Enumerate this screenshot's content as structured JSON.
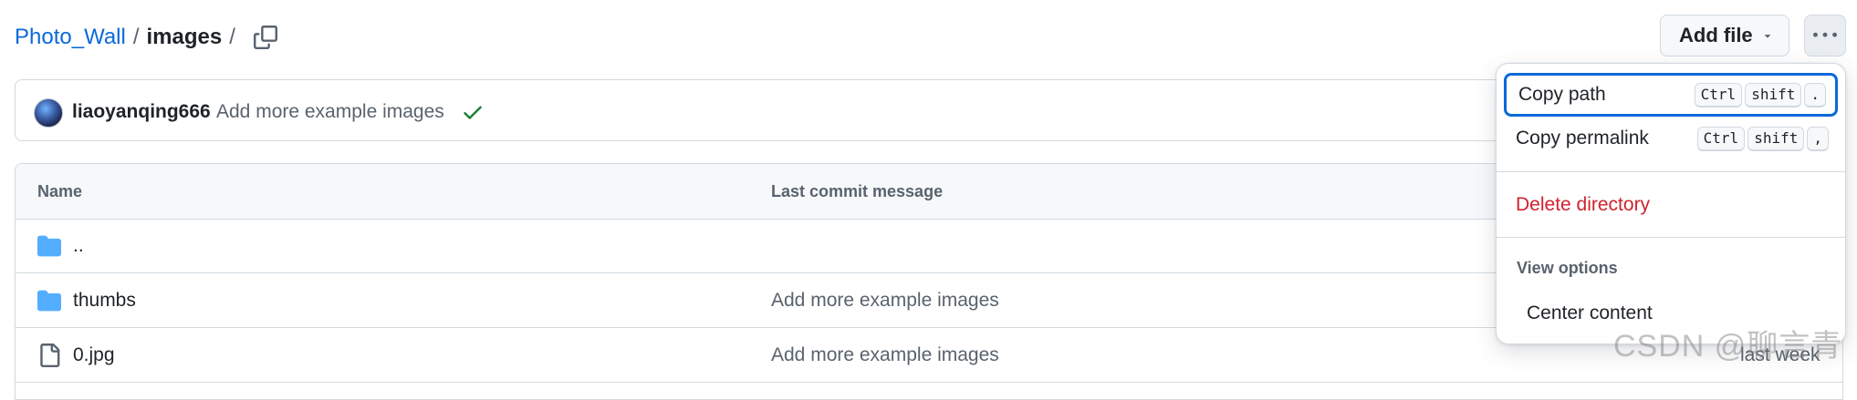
{
  "breadcrumb": {
    "repo": "Photo_Wall",
    "sep": "/",
    "dir": "images",
    "trail": "/"
  },
  "header": {
    "add_file_label": "Add file"
  },
  "commit": {
    "author": "liaoyanqing666",
    "message": "Add more example images",
    "status_color": "#1a7f37"
  },
  "table": {
    "headers": {
      "name": "Name",
      "message": "Last commit message"
    },
    "rows": [
      {
        "name": "..",
        "message": "",
        "date": "",
        "icon": "folder-icon"
      },
      {
        "name": "thumbs",
        "message": "Add more example images",
        "date": "",
        "icon": "folder-icon"
      },
      {
        "name": "0.jpg",
        "message": "Add more example images",
        "date": "last week",
        "icon": "file-icon"
      }
    ]
  },
  "menu": {
    "copy_path": {
      "label": "Copy path",
      "keys": [
        "Ctrl",
        "shift",
        "."
      ]
    },
    "copy_permalink": {
      "label": "Copy permalink",
      "keys": [
        "Ctrl",
        "shift",
        ","
      ]
    },
    "delete_directory": {
      "label": "Delete directory"
    },
    "view_options_title": "View options",
    "center_content": {
      "label": "Center content"
    }
  },
  "watermark": "CSDN @聊言青",
  "colors": {
    "link": "#0969da",
    "danger": "#cf222e",
    "folder": "#54aeff",
    "success": "#1a7f37"
  }
}
